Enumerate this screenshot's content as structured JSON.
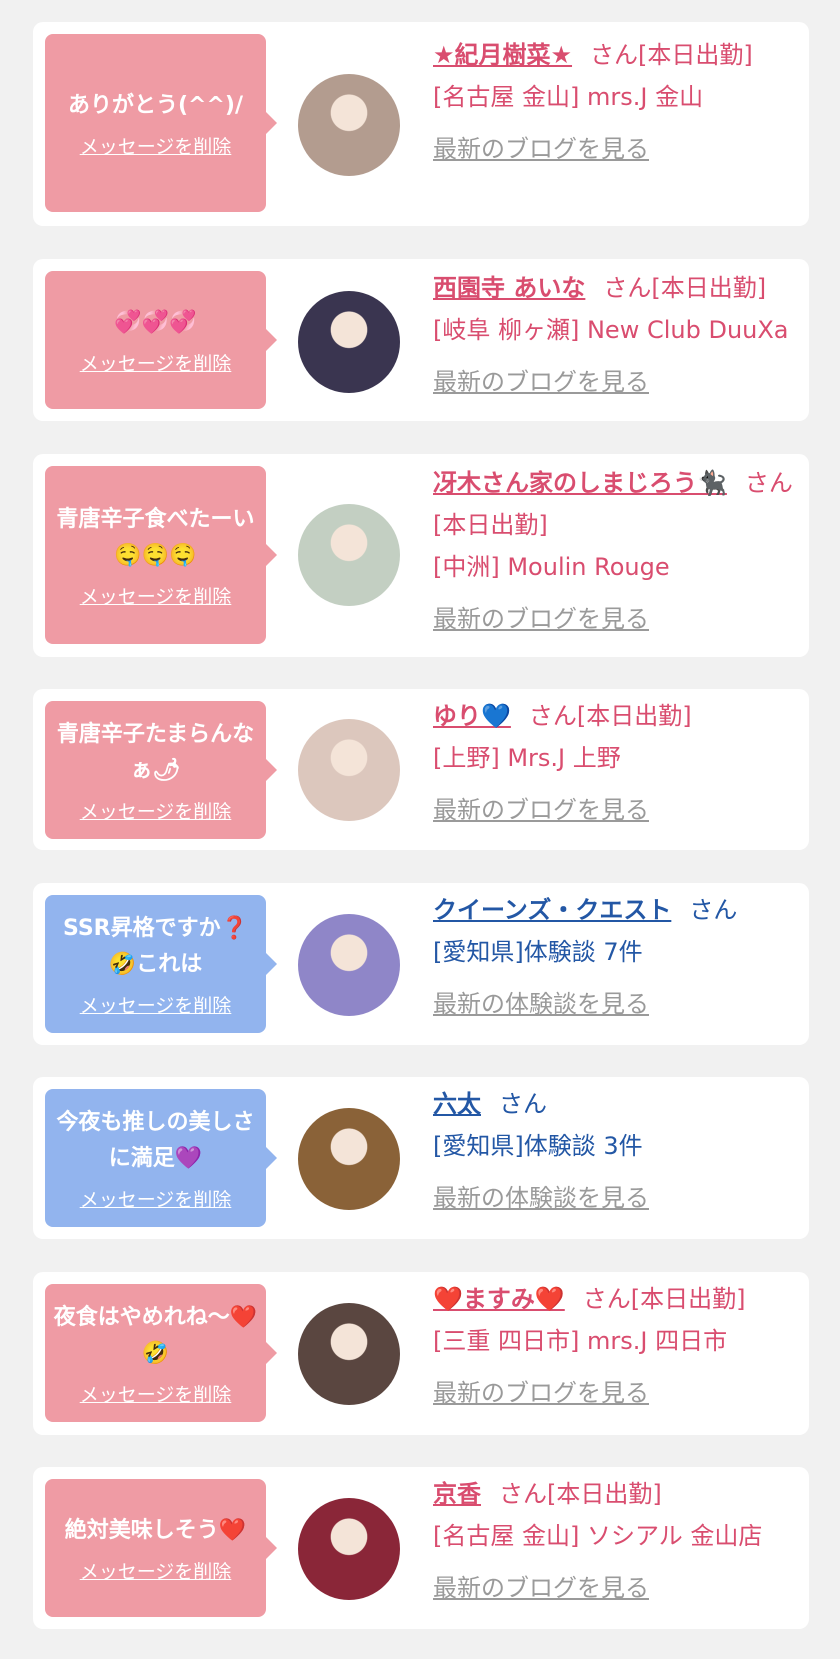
{
  "cards": [
    {
      "message": "ありがとう(^^)/",
      "delete": "メッセージを削除",
      "name": "★紀月樹菜★",
      "suffix": "さん[本日出勤]",
      "shop": "[名古屋 金山] mrs.J 金山",
      "blog": "最新のブログを見る",
      "type": "cast",
      "bubble_color": "#ef9ba4",
      "avatar_color": "#b39c8f"
    },
    {
      "message": "💞💞💞",
      "delete": "メッセージを削除",
      "name": "西園寺 あいな",
      "suffix": "さん[本日出勤]",
      "shop": "[岐阜 柳ヶ瀬] New Club DuuXa",
      "blog": "最新のブログを見る",
      "type": "cast",
      "bubble_color": "#ef9ba4",
      "avatar_color": "#3a3550"
    },
    {
      "message": "青唐辛子食べたーい🤤🤤🤤",
      "delete": "メッセージを削除",
      "name": "冴木さん家のしまじろう🐈‍⬛",
      "suffix": "さん[本日出勤]",
      "shop": "[中洲] Moulin Rouge",
      "blog": "最新のブログを見る",
      "type": "cast",
      "bubble_color": "#ef9ba4",
      "avatar_color": "#c3cfc2"
    },
    {
      "message": "青唐辛子たまらんなぁ🌶",
      "delete": "メッセージを削除",
      "name": "ゆり💙",
      "suffix": "さん[本日出勤]",
      "shop": "[上野] Mrs.J 上野",
      "blog": "最新のブログを見る",
      "type": "cast",
      "bubble_color": "#ef9ba4",
      "avatar_color": "#dcc7bd"
    },
    {
      "message": "SSR昇格ですか❓🤣これは",
      "delete": "メッセージを削除",
      "name": "クイーンズ・クエスト",
      "suffix": "さん",
      "shop": "[愛知県]体験談 7件",
      "blog": "最新の体験談を見る",
      "type": "user",
      "bubble_color": "#92b4ee",
      "avatar_color": "#8f86c8"
    },
    {
      "message": "今夜も推しの美しさに満足💜",
      "delete": "メッセージを削除",
      "name": "六太",
      "suffix": "さん",
      "shop": "[愛知県]体験談 3件",
      "blog": "最新の体験談を見る",
      "type": "user",
      "bubble_color": "#92b4ee",
      "avatar_color": "#8a6238"
    },
    {
      "message": "夜食はやめれね〜❤️🤣",
      "delete": "メッセージを削除",
      "name": "❤️ますみ❤️",
      "suffix": "さん[本日出勤]",
      "shop": "[三重 四日市] mrs.J 四日市",
      "blog": "最新のブログを見る",
      "type": "cast",
      "bubble_color": "#ef9ba4",
      "avatar_color": "#5a4640"
    },
    {
      "message": "絶対美味しそう❤️",
      "delete": "メッセージを削除",
      "name": "京香",
      "suffix": "さん[本日出勤]",
      "shop": "[名古屋 金山] ソシアル 金山店",
      "blog": "最新のブログを見る",
      "type": "cast",
      "bubble_color": "#ef9ba4",
      "avatar_color": "#8a2638"
    }
  ]
}
